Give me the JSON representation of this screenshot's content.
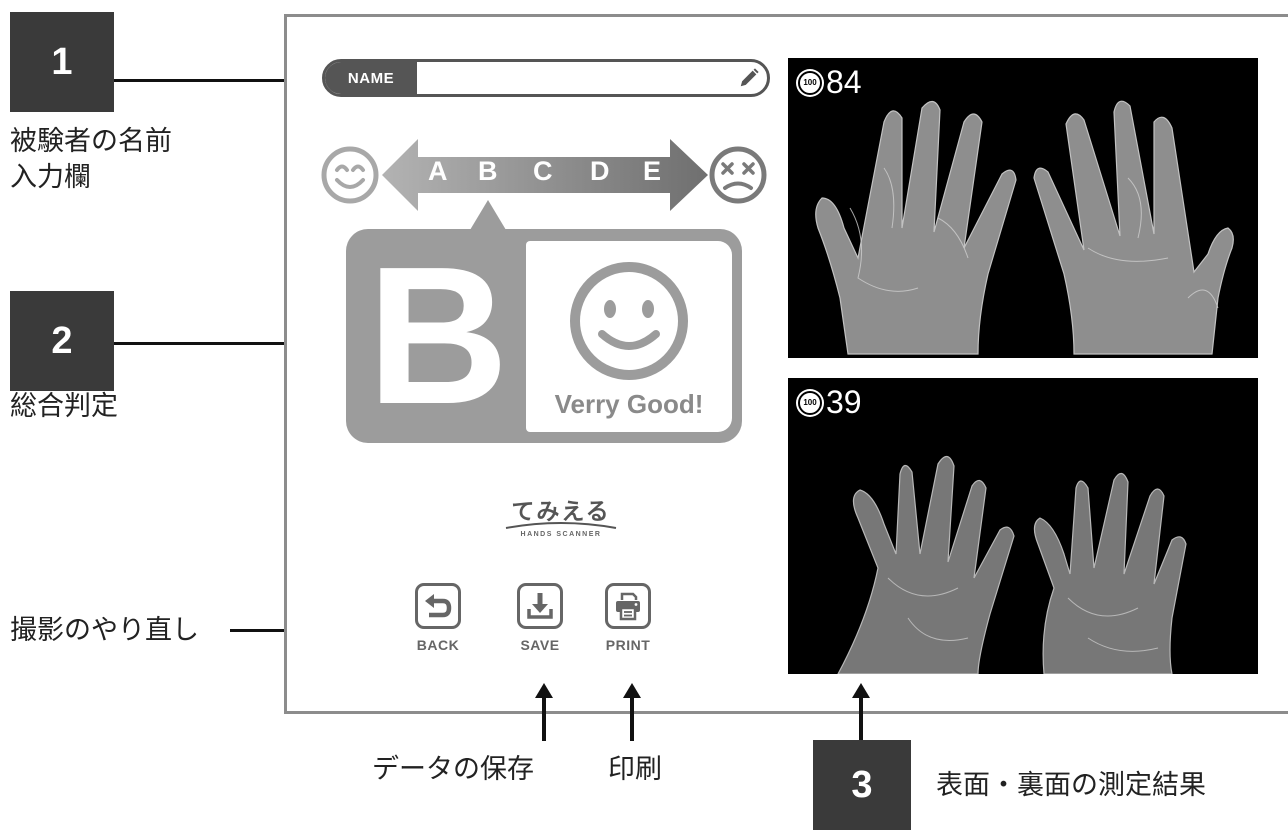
{
  "callouts": [
    {
      "number": "1",
      "text": "被験者の名前\n入力欄"
    },
    {
      "number": "2",
      "text": "総合判定"
    },
    {
      "number": "3",
      "text": "表面・裏面の測定結果"
    }
  ],
  "annotations": {
    "retake": "撮影のやり直し",
    "save_data": "データの保存",
    "print": "印刷"
  },
  "name_field": {
    "label": "NAME",
    "value": "",
    "icon": "pencil-icon"
  },
  "grade_scale": {
    "grades": [
      "A",
      "B",
      "C",
      "D",
      "E"
    ],
    "left_icon": "smiling-face-icon",
    "right_icon": "dizzy-face-icon",
    "selected": "B"
  },
  "judgement": {
    "grade": "B",
    "label": "Verry Good!",
    "icon": "smiley-face-icon"
  },
  "logo": {
    "title": "てみえる",
    "subtitle": "HANDS SCANNER"
  },
  "buttons": [
    {
      "label": "BACK",
      "icon": "back-arrow-icon"
    },
    {
      "label": "SAVE",
      "icon": "download-icon"
    },
    {
      "label": "PRINT",
      "icon": "printer-icon"
    }
  ],
  "results": [
    {
      "badge": "100",
      "score": "84"
    },
    {
      "badge": "100",
      "score": "39"
    }
  ],
  "colors": {
    "panel": "#9c9c9c",
    "frame": "#8c8c8c",
    "callout_box": "#3a3a3a"
  }
}
